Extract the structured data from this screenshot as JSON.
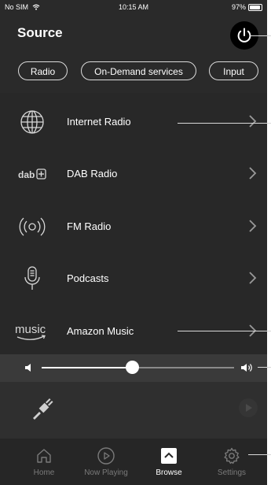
{
  "status_bar": {
    "carrier": "No SIM",
    "time": "10:15 AM",
    "battery": "97%"
  },
  "header": {
    "title": "Source"
  },
  "tabs": [
    {
      "label": "Radio"
    },
    {
      "label": "On-Demand services"
    },
    {
      "label": "Input"
    }
  ],
  "sources": [
    {
      "label": "Internet Radio",
      "icon": "globe-icon"
    },
    {
      "label": "DAB Radio",
      "icon": "dab-icon",
      "icon_text": "dab"
    },
    {
      "label": "FM Radio",
      "icon": "radio-waves-icon"
    },
    {
      "label": "Podcasts",
      "icon": "microphone-icon"
    },
    {
      "label": "Amazon Music",
      "icon": "amazon-music-icon",
      "icon_text": "music"
    }
  ],
  "volume": {
    "level": 0.47
  },
  "tab_bar": [
    {
      "label": "Home",
      "icon": "home-icon"
    },
    {
      "label": "Now Playing",
      "icon": "play-circle-icon"
    },
    {
      "label": "Browse",
      "icon": "browse-icon"
    },
    {
      "label": "Settings",
      "icon": "gear-icon"
    }
  ],
  "colors": {
    "background": "#2a2a2a",
    "text": "#ffffff",
    "muted": "#7a7a7a"
  }
}
